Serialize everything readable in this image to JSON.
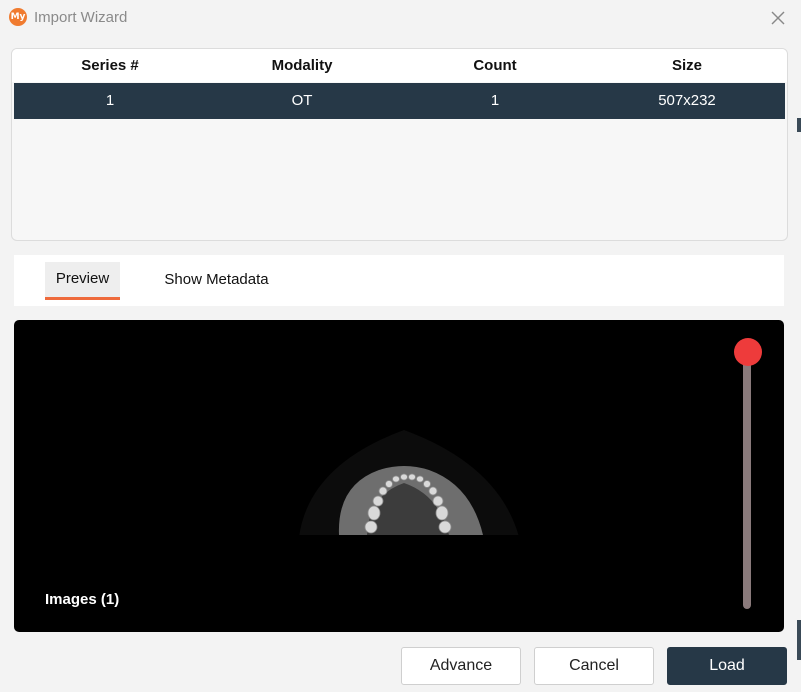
{
  "window": {
    "title": "Import Wizard",
    "logo_text": "My",
    "accent_color": "#f07b2f"
  },
  "series_table": {
    "columns": [
      "Series #",
      "Modality",
      "Count",
      "Size"
    ],
    "rows": [
      {
        "series": "1",
        "modality": "OT",
        "count": "1",
        "size": "507x232"
      }
    ],
    "selected_row_color": "#263847"
  },
  "tabs": {
    "preview": "Preview",
    "metadata": "Show Metadata",
    "active_indicator_color": "#ee6a3c"
  },
  "preview": {
    "images_label": "Images (1)",
    "slider_color": "#ee3b3b"
  },
  "buttons": {
    "advance": "Advance",
    "cancel": "Cancel",
    "load": "Load"
  }
}
